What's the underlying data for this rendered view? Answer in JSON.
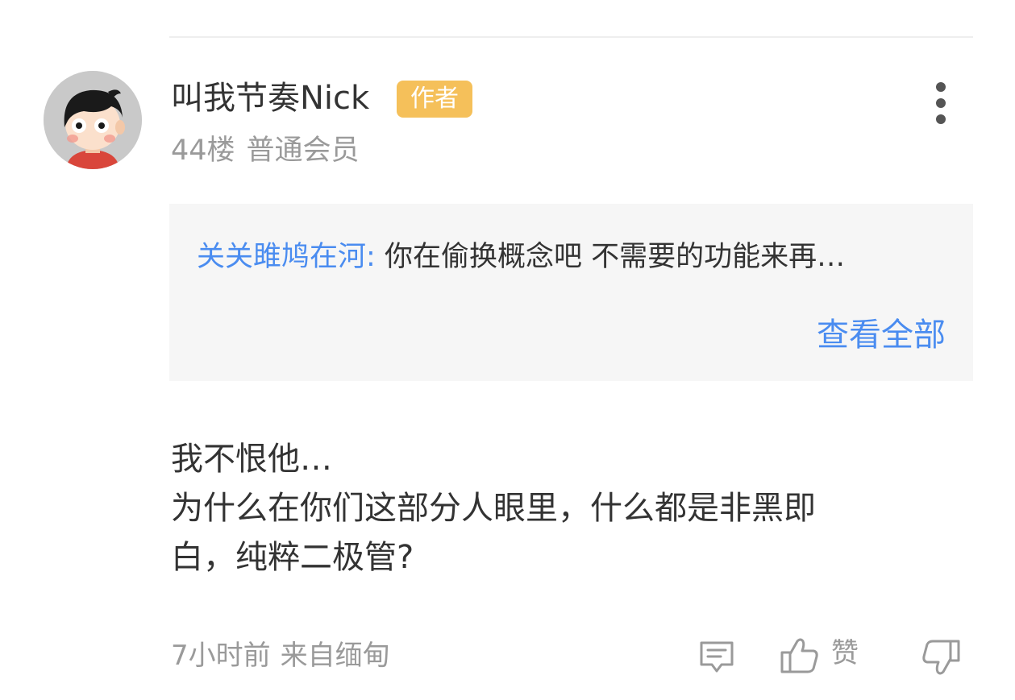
{
  "comment": {
    "username": "叫我节奏Nick",
    "badge": "作者",
    "floor": "44楼",
    "member_level": "普通会员",
    "quote": {
      "author": "关关雎鸠在河:",
      "text": "你在偷换概念吧  不需要的功能来再…",
      "view_all_label": "查看全部"
    },
    "body_lines": [
      "我不恨他…",
      "为什么在你们这部分人眼里，什么都是非黑即",
      "白，纯粹二极管?"
    ],
    "time": "7小时前",
    "source": "来自缅甸",
    "like_label": "赞"
  },
  "icons": {
    "avatar": "cartoon-avatar",
    "more": "vertical-ellipsis-icon",
    "reply": "comment-icon",
    "like": "thumbs-up-icon",
    "dislike": "thumbs-down-icon"
  },
  "colors": {
    "badge_background": "#f5c05a",
    "link_blue": "#4a8cf0",
    "quote_background": "#f6f6f6",
    "muted_text": "#9a9a9a"
  }
}
